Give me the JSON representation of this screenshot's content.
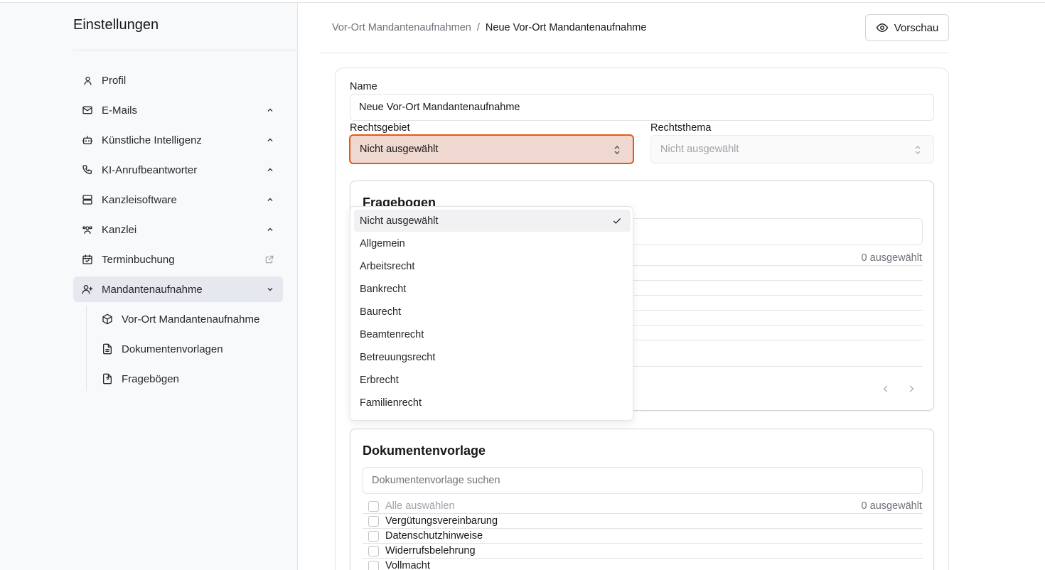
{
  "sidebar": {
    "title": "Einstellungen",
    "items": [
      {
        "label": "Profil",
        "icon": "user-icon"
      },
      {
        "label": "E-Mails",
        "icon": "mail-icon"
      },
      {
        "label": "Künstliche Intelligenz",
        "icon": "bot-icon"
      },
      {
        "label": "KI-Anrufbeantworter",
        "icon": "phone-icon"
      },
      {
        "label": "Kanzleisoftware",
        "icon": "server-icon"
      },
      {
        "label": "Kanzlei",
        "icon": "users-icon"
      },
      {
        "label": "Terminbuchung",
        "icon": "calendar-check-icon"
      },
      {
        "label": "Mandantenaufnahme",
        "icon": "user-plus-icon"
      }
    ],
    "subitems": [
      {
        "label": "Vor-Ort Mandantenaufnahme",
        "icon": "package-icon"
      },
      {
        "label": "Dokumentenvorlagen",
        "icon": "file-text-icon"
      },
      {
        "label": "Fragebögen",
        "icon": "file-question-icon"
      }
    ]
  },
  "header": {
    "breadcrumb_parent": "Vor-Ort Mandantenaufnahmen",
    "breadcrumb_sep": "/",
    "breadcrumb_current": "Neue Vor-Ort Mandantenaufnahme",
    "preview_label": "Vorschau"
  },
  "form": {
    "name_label": "Name",
    "name_value": "Neue Vor-Ort Mandantenaufnahme",
    "rechtsgebiet_label": "Rechtsgebiet",
    "rechtsgebiet_value": "Nicht ausgewählt",
    "rechtsthema_label": "Rechtsthema",
    "rechtsthema_value": "Nicht ausgewählt"
  },
  "fragebogen": {
    "title": "Fragebogen",
    "count": "0 ausgewählt"
  },
  "dokumentenvorlage": {
    "title": "Dokumentenvorlage",
    "search_placeholder": "Dokumentenvorlage suchen",
    "select_all": "Alle auswählen",
    "count": "0 ausgewählt",
    "rows": [
      "Vergütungsvereinbarung",
      "Datenschutzhinweise",
      "Widerrufsbelehrung",
      "Vollmacht"
    ]
  },
  "dropdown": {
    "options": [
      "Nicht ausgewählt",
      "Allgemein",
      "Arbeitsrecht",
      "Bankrecht",
      "Baurecht",
      "Beamtenrecht",
      "Betreuungsrecht",
      "Erbrecht",
      "Familienrecht"
    ],
    "selected": "Nicht ausgewählt"
  },
  "colors": {
    "accent": "#ea580c",
    "select_highlight": "#efd8cf",
    "sidebar_bg": "#f8f9fa",
    "active_nav_bg": "#e5e9ef"
  }
}
